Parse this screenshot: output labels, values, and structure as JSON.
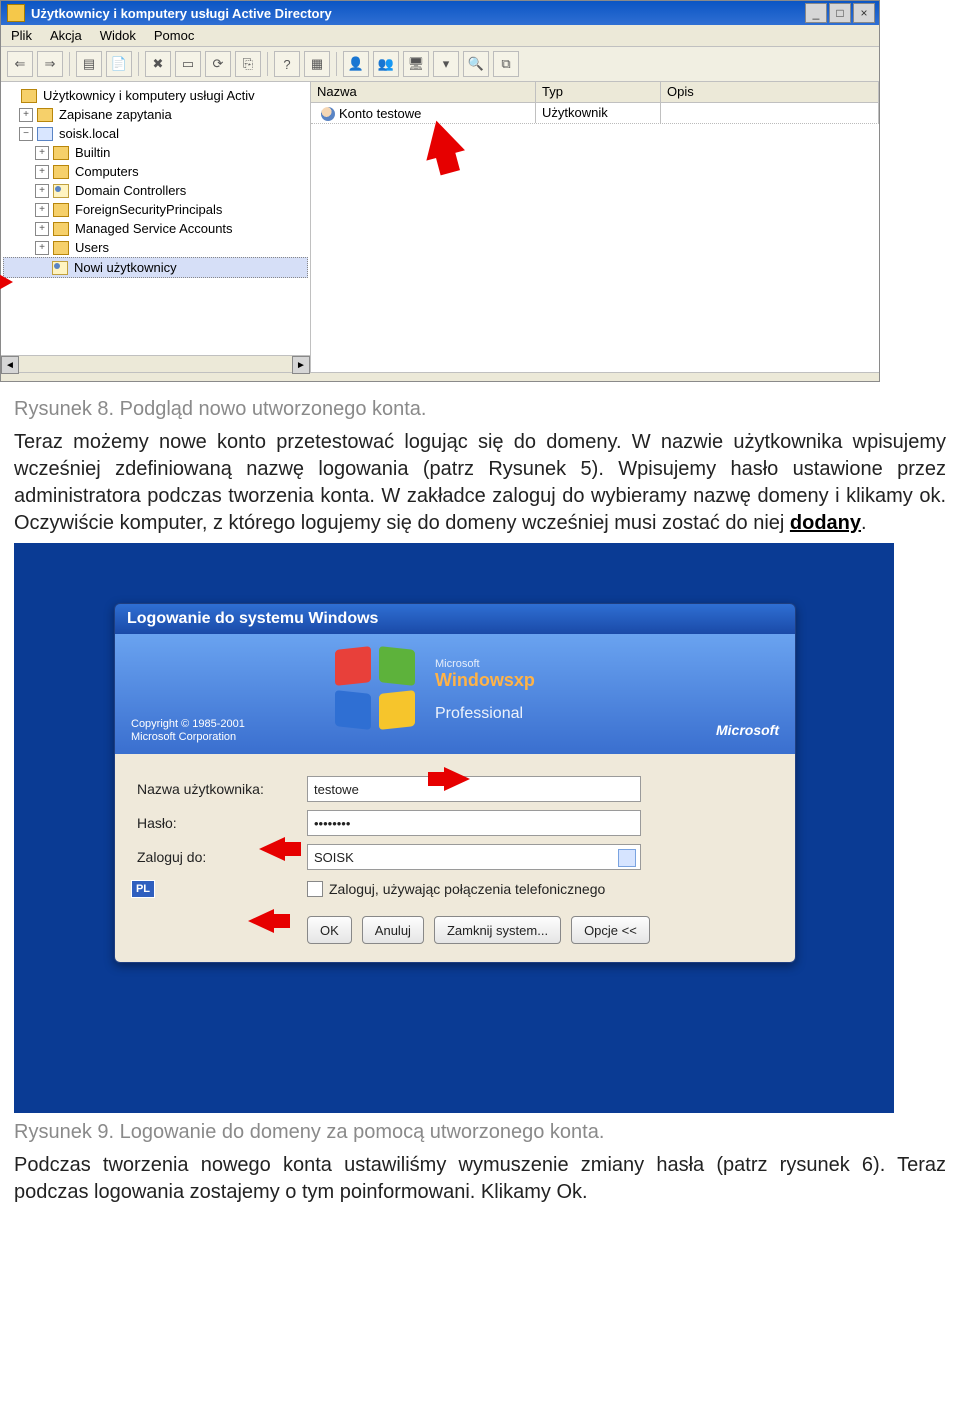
{
  "ad_window": {
    "title": "Użytkownicy i komputery usługi Active Directory",
    "menus": {
      "plik": "Plik",
      "akcja": "Akcja",
      "widok": "Widok",
      "pomoc": "Pomoc"
    },
    "tree": {
      "root": "Użytkownicy i komputery usługi Activ",
      "saved_queries": "Zapisane zapytania",
      "domain": "soisk.local",
      "builtin": "Builtin",
      "computers": "Computers",
      "dcs": "Domain Controllers",
      "fsp": "ForeignSecurityPrincipals",
      "msa": "Managed Service Accounts",
      "users": "Users",
      "new_users": "Nowi użytkownicy"
    },
    "list": {
      "headers": {
        "name": "Nazwa",
        "type": "Typ",
        "desc": "Opis"
      },
      "row": {
        "name": "Konto testowe",
        "type": "Użytkownik",
        "desc": ""
      }
    }
  },
  "caption8": "Rysunek 8. Podgląd nowo utworzonego konta.",
  "para1": "Teraz możemy nowe konto przetestować logując się do domeny. W nazwie użytkownika wpisujemy wcześniej zdefiniowaną nazwę logowania (patrz Rysunek 5). Wpisujemy hasło ustawione przez administratora podczas tworzenia konta. W zakładce zaloguj do wybieramy nazwę domeny i klikamy ok. Oczywiście komputer, z którego logujemy się do domeny wcześniej musi zostać do niej ",
  "para1_link": "dodany",
  "login": {
    "title": "Logowanie do systemu Windows",
    "brand_ms": "Microsoft",
    "brand_win": "Windows",
    "brand_xp": "xp",
    "brand_pro": "Professional",
    "copyright": "Copyright © 1985-2001\nMicrosoft Corporation",
    "mslogo": "Microsoft",
    "labels": {
      "user": "Nazwa użytkownika:",
      "pass": "Hasło:",
      "domain": "Zaloguj do:"
    },
    "values": {
      "user": "testowe",
      "pass": "••••••••",
      "domain": "SOISK"
    },
    "checkbox": "Zaloguj, używając połączenia telefonicznego",
    "lang": "PL",
    "buttons": {
      "ok": "OK",
      "cancel": "Anuluj",
      "shutdown": "Zamknij system...",
      "options": "Opcje <<"
    }
  },
  "caption9": "Rysunek 9. Logowanie do domeny za pomocą utworzonego konta.",
  "para2": "Podczas tworzenia nowego konta ustawiliśmy wymuszenie zmiany hasła (patrz rysunek 6). Teraz podczas logowania zostajemy o tym poinformowani. Klikamy Ok."
}
